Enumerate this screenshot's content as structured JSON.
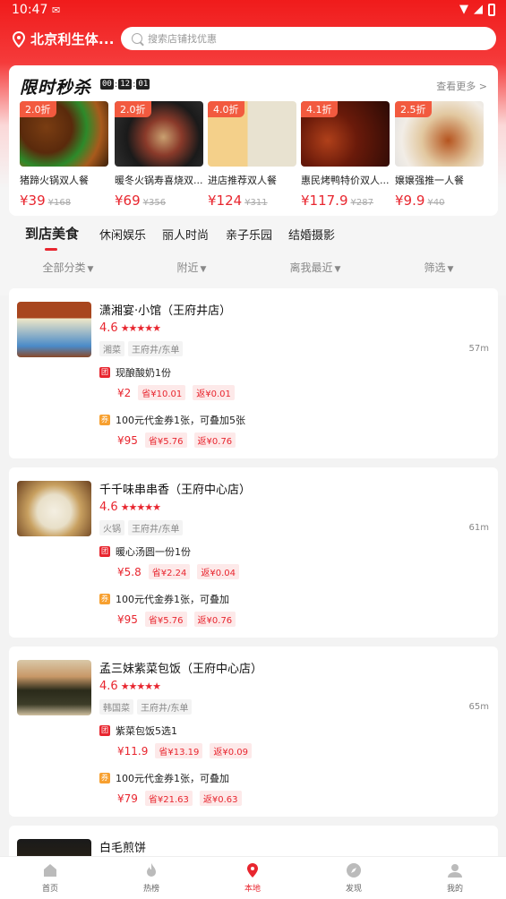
{
  "status": {
    "time": "10:47"
  },
  "location": {
    "label": "北京利生体..."
  },
  "search": {
    "placeholder": "搜索店铺找优惠"
  },
  "flash_sale": {
    "title": "限时秒杀",
    "timer": [
      "00",
      "12",
      "01"
    ],
    "more": "查看更多 >",
    "deals": [
      {
        "badge": "2.0折",
        "name": "猪蹄火锅双人餐",
        "price": "¥39",
        "orig": "¥168"
      },
      {
        "badge": "2.0折",
        "name": "暖冬火锅寿喜烧双...",
        "price": "¥69",
        "orig": "¥356"
      },
      {
        "badge": "4.0折",
        "name": "进店推荐双人餐",
        "price": "¥124",
        "orig": "¥311"
      },
      {
        "badge": "4.1折",
        "name": "惠民烤鸭特价双人...",
        "price": "¥117.9",
        "orig": "¥287"
      },
      {
        "badge": "2.5折",
        "name": "嬢嬢强推一人餐",
        "price": "¥9.9",
        "orig": "¥40"
      }
    ]
  },
  "categories": [
    "到店美食",
    "休闲娱乐",
    "丽人时尚",
    "亲子乐园",
    "结婚摄影"
  ],
  "filters": [
    "全部分类",
    "附近",
    "离我最近",
    "筛选"
  ],
  "shops": [
    {
      "name": "潇湘宴·小馆（王府井店）",
      "rating": "4.6",
      "tags": [
        "湘菜",
        "王府井/东单"
      ],
      "distance": "57m",
      "offers": [
        {
          "icon": "团",
          "title": "现酿酸奶1份",
          "price": "¥2",
          "save": "省¥10.01",
          "back": "返¥0.01"
        },
        {
          "icon": "券",
          "title": "100元代金券1张，可叠加5张",
          "price": "¥95",
          "save": "省¥5.76",
          "back": "返¥0.76"
        }
      ]
    },
    {
      "name": "千千味串串香（王府中心店）",
      "rating": "4.6",
      "tags": [
        "火锅",
        "王府井/东单"
      ],
      "distance": "61m",
      "offers": [
        {
          "icon": "团",
          "title": "暖心汤圆一份1份",
          "price": "¥5.8",
          "save": "省¥2.24",
          "back": "返¥0.04"
        },
        {
          "icon": "券",
          "title": "100元代金券1张，可叠加",
          "price": "¥95",
          "save": "省¥5.76",
          "back": "返¥0.76"
        }
      ]
    },
    {
      "name": "孟三妹紫菜包饭（王府中心店）",
      "rating": "4.6",
      "tags": [
        "韩国菜",
        "王府井/东单"
      ],
      "distance": "65m",
      "offers": [
        {
          "icon": "团",
          "title": "紫菜包饭5选1",
          "price": "¥11.9",
          "save": "省¥13.19",
          "back": "返¥0.09"
        },
        {
          "icon": "券",
          "title": "100元代金券1张，可叠加",
          "price": "¥79",
          "save": "省¥21.63",
          "back": "返¥0.63"
        }
      ]
    },
    {
      "name": "白毛煎饼"
    }
  ],
  "tabbar": [
    "首页",
    "热榜",
    "本地",
    "发现",
    "我的"
  ],
  "colors": {
    "brand": "#f01b1b",
    "price": "#e8262f",
    "deal_badge": "#f25a3f",
    "coupon_icon": "#f7a030"
  }
}
